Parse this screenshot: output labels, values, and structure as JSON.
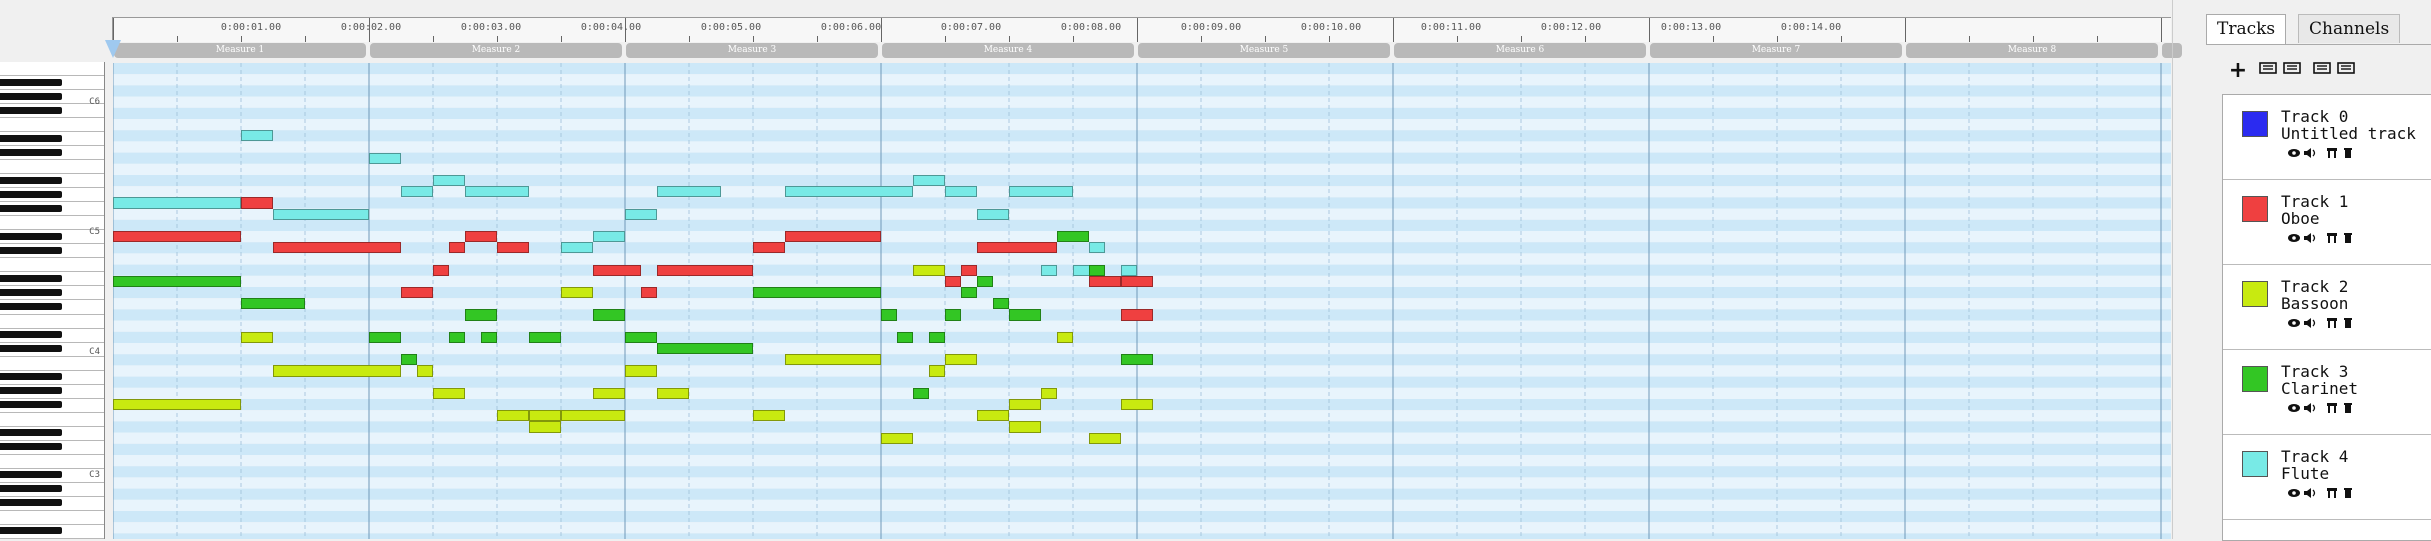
{
  "piano": {
    "labels": [
      {
        "text": "C6"
      },
      {
        "text": "C5"
      },
      {
        "text": "C4"
      },
      {
        "text": "C3"
      }
    ]
  },
  "ruler": {
    "time_labels": [
      "0:00:01.00",
      "0:00:02.00",
      "0:00:03.00",
      "0:00:04.00",
      "0:00:05.00",
      "0:00:06.00",
      "0:00:07.00",
      "0:00:08.00",
      "0:00:09.00",
      "0:00:10.00",
      "0:00:11.00",
      "0:00:12.00",
      "0:00:13.00",
      "0:00:14.00"
    ],
    "measures": [
      "Measure 1",
      "Measure 2",
      "Measure 3",
      "Measure 4",
      "Measure 5",
      "Measure 6",
      "Measure 7",
      "Measure 8"
    ]
  },
  "panel": {
    "tabs": [
      {
        "label": "Tracks",
        "active": true
      },
      {
        "label": "Channels",
        "active": false
      }
    ],
    "toolbar": [
      {
        "icon": "plus-icon"
      },
      {
        "icon": "show-all-icon"
      },
      {
        "icon": "mute-all-icon"
      },
      {
        "icon": "hide-all-icon"
      },
      {
        "icon": "reset-view-icon"
      }
    ],
    "tracks": [
      {
        "name": "Track 0",
        "instrument": "Untitled track",
        "color": "#2b2bf0"
      },
      {
        "name": "Track 1",
        "instrument": "Oboe",
        "color": "#ef4040"
      },
      {
        "name": "Track 2",
        "instrument": "Bassoon",
        "color": "#c8ea10"
      },
      {
        "name": "Track 3",
        "instrument": "Clarinet",
        "color": "#33c624"
      },
      {
        "name": "Track 4",
        "instrument": "Flute",
        "color": "#78eae6"
      }
    ]
  },
  "notes": [
    {
      "track": 4,
      "start": 0.0,
      "dur": 2.0,
      "pitch": 75
    },
    {
      "track": 1,
      "start": 0.0,
      "dur": 2.0,
      "pitch": 72
    },
    {
      "track": 3,
      "start": 0.0,
      "dur": 2.0,
      "pitch": 68
    },
    {
      "track": 2,
      "start": 0.0,
      "dur": 2.0,
      "pitch": 57
    },
    {
      "track": 4,
      "start": 2.0,
      "dur": 0.5,
      "pitch": 81
    },
    {
      "track": 1,
      "start": 2.0,
      "dur": 0.5,
      "pitch": 75
    },
    {
      "track": 3,
      "start": 2.0,
      "dur": 1.0,
      "pitch": 66
    },
    {
      "track": 2,
      "start": 2.0,
      "dur": 0.5,
      "pitch": 63
    },
    {
      "track": 4,
      "start": 2.5,
      "dur": 1.5,
      "pitch": 74
    },
    {
      "track": 1,
      "start": 2.5,
      "dur": 2.0,
      "pitch": 71
    },
    {
      "track": 2,
      "start": 2.5,
      "dur": 2.0,
      "pitch": 60
    },
    {
      "track": 4,
      "start": 4.0,
      "dur": 0.5,
      "pitch": 79
    },
    {
      "track": 3,
      "start": 4.0,
      "dur": 0.5,
      "pitch": 63
    },
    {
      "track": 4,
      "start": 4.5,
      "dur": 0.5,
      "pitch": 76
    },
    {
      "track": 1,
      "start": 4.5,
      "dur": 0.5,
      "pitch": 67
    },
    {
      "track": 3,
      "start": 4.5,
      "dur": 0.25,
      "pitch": 61
    },
    {
      "track": 2,
      "start": 4.75,
      "dur": 0.25,
      "pitch": 60
    },
    {
      "track": 4,
      "start": 5.0,
      "dur": 0.5,
      "pitch": 77
    },
    {
      "track": 1,
      "start": 5.0,
      "dur": 0.25,
      "pitch": 69
    },
    {
      "track": 2,
      "start": 5.0,
      "dur": 0.5,
      "pitch": 58
    },
    {
      "track": 1,
      "start": 5.25,
      "dur": 0.25,
      "pitch": 71
    },
    {
      "track": 3,
      "start": 5.25,
      "dur": 0.25,
      "pitch": 63
    },
    {
      "track": 4,
      "start": 5.5,
      "dur": 1.0,
      "pitch": 76
    },
    {
      "track": 1,
      "start": 5.5,
      "dur": 0.5,
      "pitch": 72
    },
    {
      "track": 3,
      "start": 5.5,
      "dur": 0.5,
      "pitch": 65
    },
    {
      "track": 3,
      "start": 5.75,
      "dur": 0.25,
      "pitch": 63
    },
    {
      "track": 1,
      "start": 6.0,
      "dur": 0.5,
      "pitch": 71
    },
    {
      "track": 2,
      "start": 6.0,
      "dur": 0.5,
      "pitch": 56
    },
    {
      "track": 3,
      "start": 6.5,
      "dur": 0.5,
      "pitch": 63
    },
    {
      "track": 2,
      "start": 6.5,
      "dur": 0.5,
      "pitch": 56
    },
    {
      "track": 2,
      "start": 6.5,
      "dur": 0.5,
      "pitch": 55
    },
    {
      "track": 4,
      "start": 7.0,
      "dur": 0.5,
      "pitch": 71
    },
    {
      "track": 2,
      "start": 7.0,
      "dur": 0.5,
      "pitch": 67
    },
    {
      "track": 2,
      "start": 7.0,
      "dur": 1.0,
      "pitch": 56
    },
    {
      "track": 4,
      "start": 7.5,
      "dur": 0.5,
      "pitch": 72
    },
    {
      "track": 1,
      "start": 7.5,
      "dur": 0.75,
      "pitch": 69
    },
    {
      "track": 3,
      "start": 7.5,
      "dur": 0.5,
      "pitch": 65
    },
    {
      "track": 2,
      "start": 7.5,
      "dur": 0.5,
      "pitch": 58
    },
    {
      "track": 4,
      "start": 8.0,
      "dur": 0.5,
      "pitch": 74
    },
    {
      "track": 3,
      "start": 8.0,
      "dur": 0.5,
      "pitch": 63
    },
    {
      "track": 2,
      "start": 8.0,
      "dur": 0.5,
      "pitch": 60
    },
    {
      "track": 1,
      "start": 8.25,
      "dur": 0.25,
      "pitch": 67
    },
    {
      "track": 4,
      "start": 8.5,
      "dur": 1.0,
      "pitch": 76
    },
    {
      "track": 1,
      "start": 8.5,
      "dur": 1.5,
      "pitch": 69
    },
    {
      "track": 3,
      "start": 8.5,
      "dur": 1.5,
      "pitch": 62
    },
    {
      "track": 2,
      "start": 8.5,
      "dur": 0.5,
      "pitch": 58
    },
    {
      "track": 1,
      "start": 10.0,
      "dur": 0.5,
      "pitch": 71
    },
    {
      "track": 3,
      "start": 10.0,
      "dur": 2.0,
      "pitch": 67
    },
    {
      "track": 2,
      "start": 10.0,
      "dur": 0.5,
      "pitch": 56
    },
    {
      "track": 4,
      "start": 10.5,
      "dur": 2.0,
      "pitch": 76
    },
    {
      "track": 1,
      "start": 10.5,
      "dur": 1.5,
      "pitch": 72
    },
    {
      "track": 2,
      "start": 10.5,
      "dur": 1.5,
      "pitch": 61
    },
    {
      "track": 3,
      "start": 12.0,
      "dur": 0.25,
      "pitch": 65
    },
    {
      "track": 2,
      "start": 12.0,
      "dur": 0.5,
      "pitch": 54
    },
    {
      "track": 3,
      "start": 12.25,
      "dur": 0.25,
      "pitch": 63
    },
    {
      "track": 4,
      "start": 12.5,
      "dur": 0.5,
      "pitch": 77
    },
    {
      "track": 2,
      "start": 12.5,
      "dur": 0.5,
      "pitch": 69
    },
    {
      "track": 3,
      "start": 12.5,
      "dur": 0.25,
      "pitch": 58
    },
    {
      "track": 3,
      "start": 12.75,
      "dur": 0.25,
      "pitch": 63
    },
    {
      "track": 2,
      "start": 12.75,
      "dur": 0.25,
      "pitch": 60
    },
    {
      "track": 4,
      "start": 13.0,
      "dur": 0.5,
      "pitch": 76
    },
    {
      "track": 1,
      "start": 13.0,
      "dur": 0.25,
      "pitch": 68
    },
    {
      "track": 3,
      "start": 13.0,
      "dur": 0.25,
      "pitch": 65
    },
    {
      "track": 2,
      "start": 13.0,
      "dur": 0.5,
      "pitch": 61
    },
    {
      "track": 3,
      "start": 13.25,
      "dur": 0.25,
      "pitch": 67
    },
    {
      "track": 1,
      "start": 13.25,
      "dur": 0.25,
      "pitch": 69
    },
    {
      "track": 4,
      "start": 13.5,
      "dur": 0.5,
      "pitch": 74
    },
    {
      "track": 1,
      "start": 13.5,
      "dur": 1.25,
      "pitch": 71
    },
    {
      "track": 3,
      "start": 13.5,
      "dur": 0.25,
      "pitch": 68
    },
    {
      "track": 2,
      "start": 13.5,
      "dur": 0.5,
      "pitch": 56
    },
    {
      "track": 3,
      "start": 13.75,
      "dur": 0.25,
      "pitch": 66
    },
    {
      "track": 4,
      "start": 14.0,
      "dur": 1.0,
      "pitch": 76
    },
    {
      "track": 3,
      "start": 14.0,
      "dur": 0.5,
      "pitch": 65
    },
    {
      "track": 2,
      "start": 14.0,
      "dur": 0.5,
      "pitch": 57
    },
    {
      "track": 2,
      "start": 14.0,
      "dur": 0.5,
      "pitch": 55
    },
    {
      "track": 4,
      "start": 14.5,
      "dur": 0.25,
      "pitch": 69
    },
    {
      "track": 2,
      "start": 14.5,
      "dur": 0.25,
      "pitch": 58
    },
    {
      "track": 3,
      "start": 14.75,
      "dur": 0.5,
      "pitch": 72
    },
    {
      "track": 2,
      "start": 14.75,
      "dur": 0.25,
      "pitch": 63
    },
    {
      "track": 4,
      "start": 15.0,
      "dur": 0.5,
      "pitch": 69
    },
    {
      "track": 4,
      "start": 15.25,
      "dur": 0.25,
      "pitch": 71
    },
    {
      "track": 1,
      "start": 15.25,
      "dur": 0.5,
      "pitch": 68
    },
    {
      "track": 3,
      "start": 15.25,
      "dur": 0.25,
      "pitch": 69
    },
    {
      "track": 2,
      "start": 15.25,
      "dur": 0.5,
      "pitch": 54
    },
    {
      "track": 4,
      "start": 15.75,
      "dur": 0.25,
      "pitch": 69
    },
    {
      "track": 1,
      "start": 15.75,
      "dur": 0.5,
      "pitch": 68
    },
    {
      "track": 1,
      "start": 15.75,
      "dur": 0.5,
      "pitch": 65
    },
    {
      "track": 3,
      "start": 15.75,
      "dur": 0.5,
      "pitch": 61
    },
    {
      "track": 2,
      "start": 15.75,
      "dur": 0.5,
      "pitch": 57
    }
  ]
}
